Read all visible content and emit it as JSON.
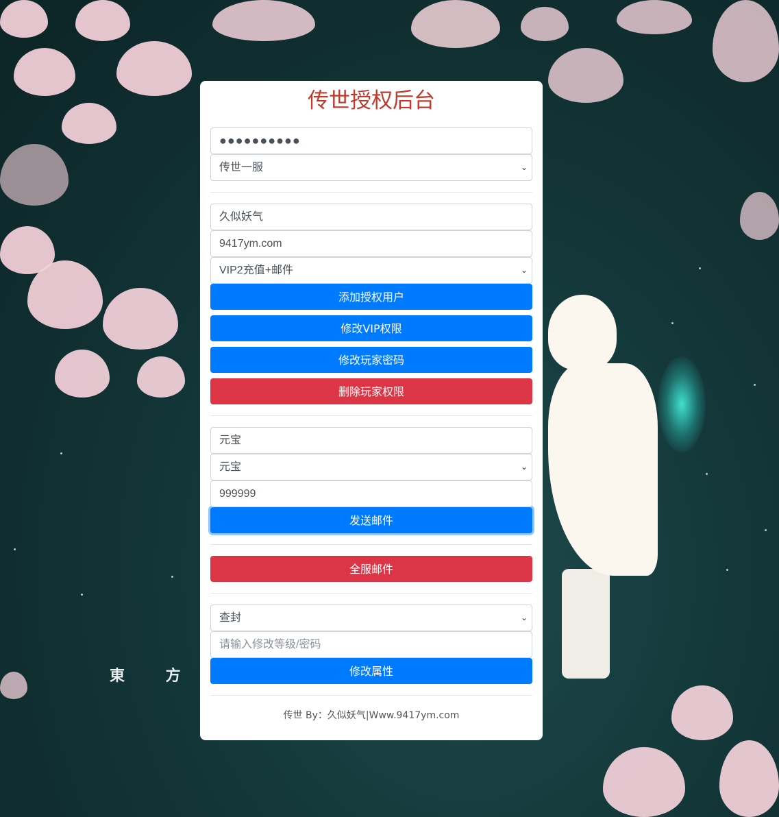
{
  "page": {
    "title": "传世授权后台",
    "background_caption": "東 方 幽",
    "accent_color": "#007bff",
    "danger_color": "#dc3545",
    "title_color": "#c0392b"
  },
  "auth": {
    "password_value": "●●●●●●●●●●",
    "server_select": "传世一服",
    "chevron_glyph": "⌄"
  },
  "player": {
    "account_value": "久似妖气",
    "site_value": "9417ym.com",
    "vip_select": "VIP2充值+邮件",
    "add_user_label": "添加授权用户",
    "modify_vip_label": "修改VIP权限",
    "modify_password_label": "修改玩家密码",
    "delete_permission_label": "删除玩家权限"
  },
  "mail": {
    "item_name_value": "元宝",
    "item_select": "元宝",
    "quantity_value": "999999",
    "send_mail_label": "发送邮件"
  },
  "server_mail": {
    "all_server_mail_label": "全服邮件"
  },
  "attributes": {
    "action_select": "查封",
    "modify_placeholder": "请输入修改等级/密码",
    "modify_attr_label": "修改属性"
  },
  "footer": {
    "text": "传世 By：久似妖气|Www.9417ym.com"
  }
}
